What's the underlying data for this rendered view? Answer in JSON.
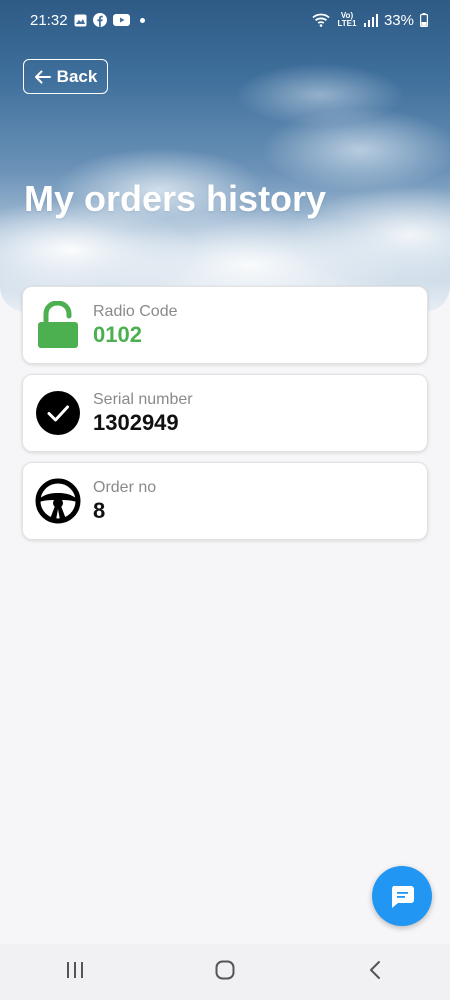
{
  "status_bar": {
    "time": "21:32",
    "network": "Vo) LTE1",
    "battery": "33%"
  },
  "header": {
    "back_label": "Back",
    "title": "My orders history"
  },
  "cards": [
    {
      "label": "Radio Code",
      "value": "0102",
      "icon": "unlocked-padlock-icon"
    },
    {
      "label": "Serial number",
      "value": "1302949",
      "icon": "check-circle-icon"
    },
    {
      "label": "Order no",
      "value": "8",
      "icon": "steering-wheel-icon"
    }
  ],
  "colors": {
    "accent_green": "#4caf50",
    "fab_blue": "#2196f3",
    "header_sky_top": "#2e5b86"
  },
  "nav": {
    "icons": [
      "recent-apps-icon",
      "home-icon",
      "back-nav-icon"
    ]
  }
}
